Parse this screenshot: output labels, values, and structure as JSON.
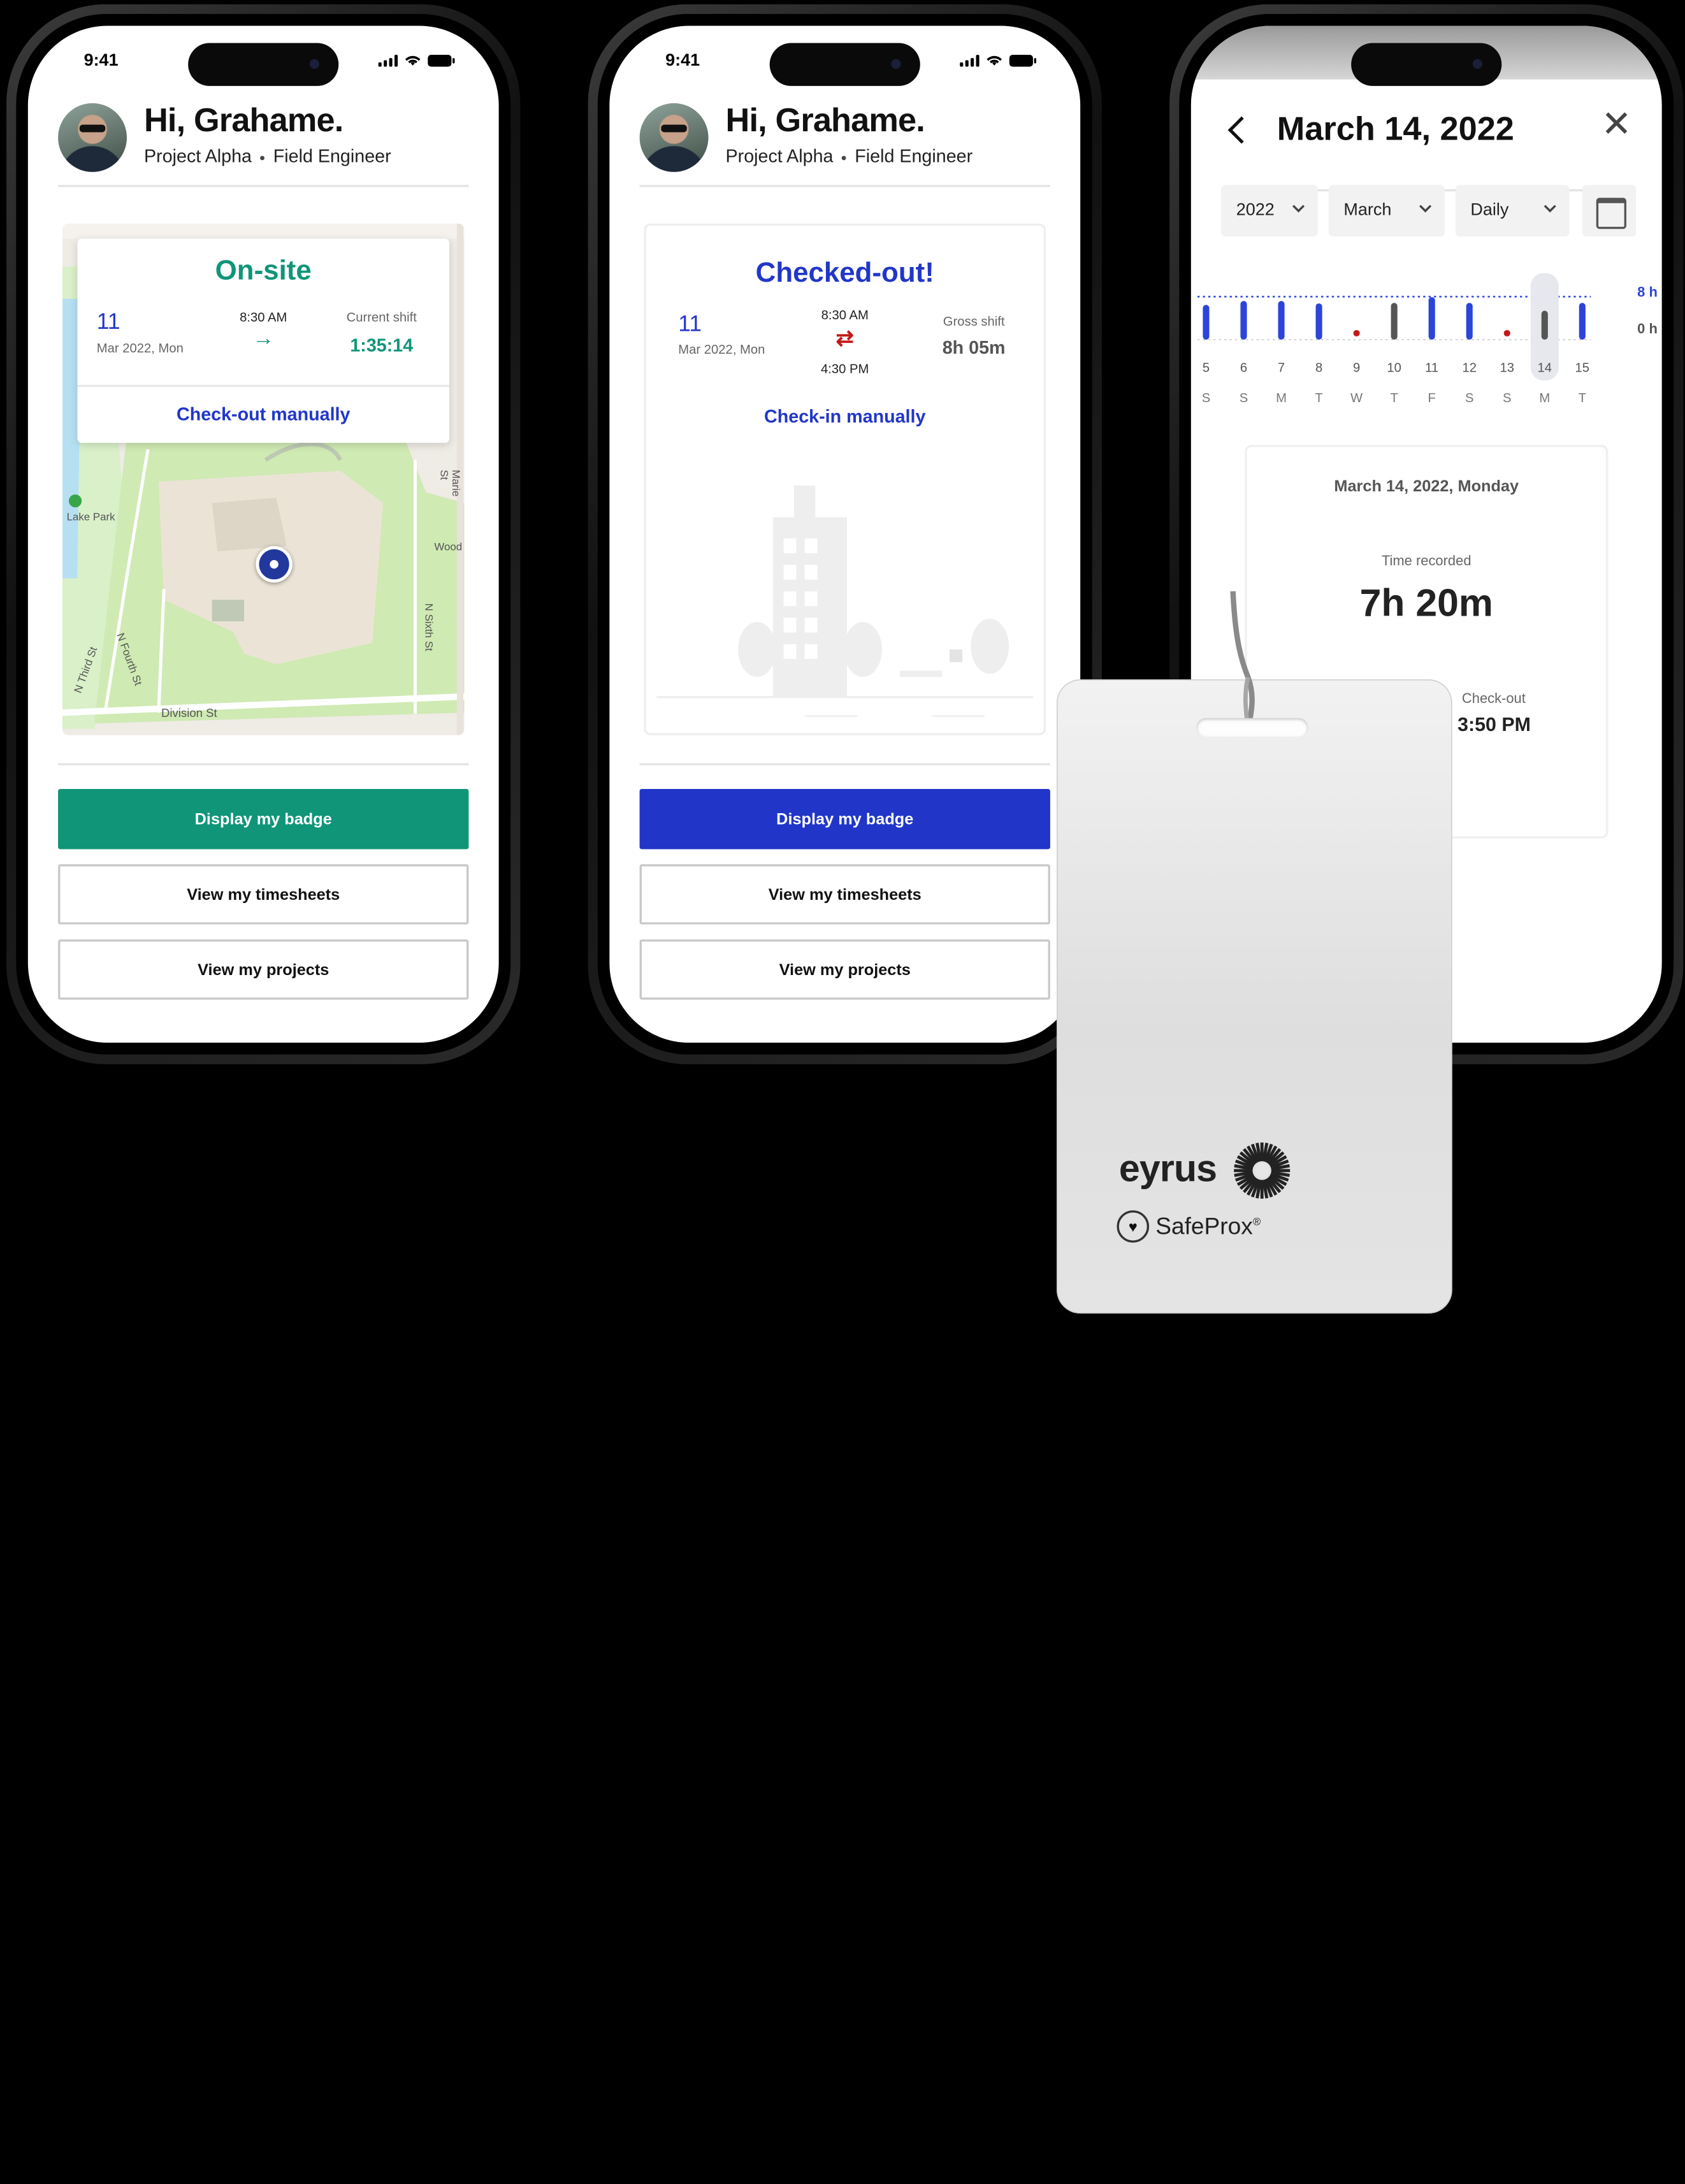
{
  "status_time": "9:41",
  "user": {
    "greeting": "Hi, Grahame.",
    "project": "Project Alpha",
    "role": "Field Engineer"
  },
  "colors": {
    "onsite": "#109579",
    "checkedout": "#2136c8",
    "blue_bar": "#2b44d9",
    "gray_bar": "#555555",
    "rest_dot": "#c21a1a"
  },
  "phone1": {
    "status": "On-site",
    "day": "11",
    "month": "Mar 2022, Mon",
    "check_in": "8:30 AM",
    "arrow": "→",
    "shift_label": "Current shift",
    "shift_value": "1:35:14",
    "manual_action": "Check-out manually",
    "map_labels": {
      "park": "Lake Park",
      "street": "Division St",
      "marie": "Marie St",
      "sixth": "N Sixth St",
      "fourth": "N Fourth St",
      "third": "N Third St",
      "wood": "Wood"
    }
  },
  "phone2": {
    "status": "Checked-out!",
    "day": "11",
    "month": "Mar 2022, Mon",
    "check_in": "8:30 AM",
    "check_out": "4:30 PM",
    "arrow": "⇄",
    "shift_label": "Gross shift",
    "shift_value": "8h 05m",
    "manual_action": "Check-in manually"
  },
  "buttons": {
    "badge": "Display my badge",
    "timesheets": "View my timesheets",
    "projects": "View my projects"
  },
  "phone3": {
    "title": "March 14, 2022",
    "year": "2022",
    "month": "March",
    "period": "Daily",
    "axis_top": "8 h",
    "axis_bottom": "0 h",
    "detail_date": "March 14, 2022, Monday",
    "time_recorded_label": "Time recorded",
    "time_recorded": "7h 20m",
    "checkout_label": "Check-out",
    "checkout_value": "3:50 PM"
  },
  "chart_data": {
    "type": "bar",
    "categories": [
      "5",
      "6",
      "7",
      "8",
      "9",
      "10",
      "11",
      "12",
      "13",
      "14",
      "15"
    ],
    "weekdays": [
      "S",
      "S",
      "M",
      "T",
      "W",
      "T",
      "F",
      "S",
      "S",
      "M",
      "T"
    ],
    "values": [
      7.2,
      8.0,
      8.0,
      7.5,
      0,
      7.6,
      8.8,
      7.6,
      0,
      6.0,
      7.6
    ],
    "kind": [
      "work",
      "work",
      "work",
      "work",
      "rest",
      "past",
      "work",
      "work",
      "rest",
      "selected",
      "work"
    ],
    "selected": "14",
    "ylim": [
      0,
      8
    ]
  },
  "badge": {
    "brand": "eyrus",
    "product": "SafeProx",
    "reg": "®"
  }
}
